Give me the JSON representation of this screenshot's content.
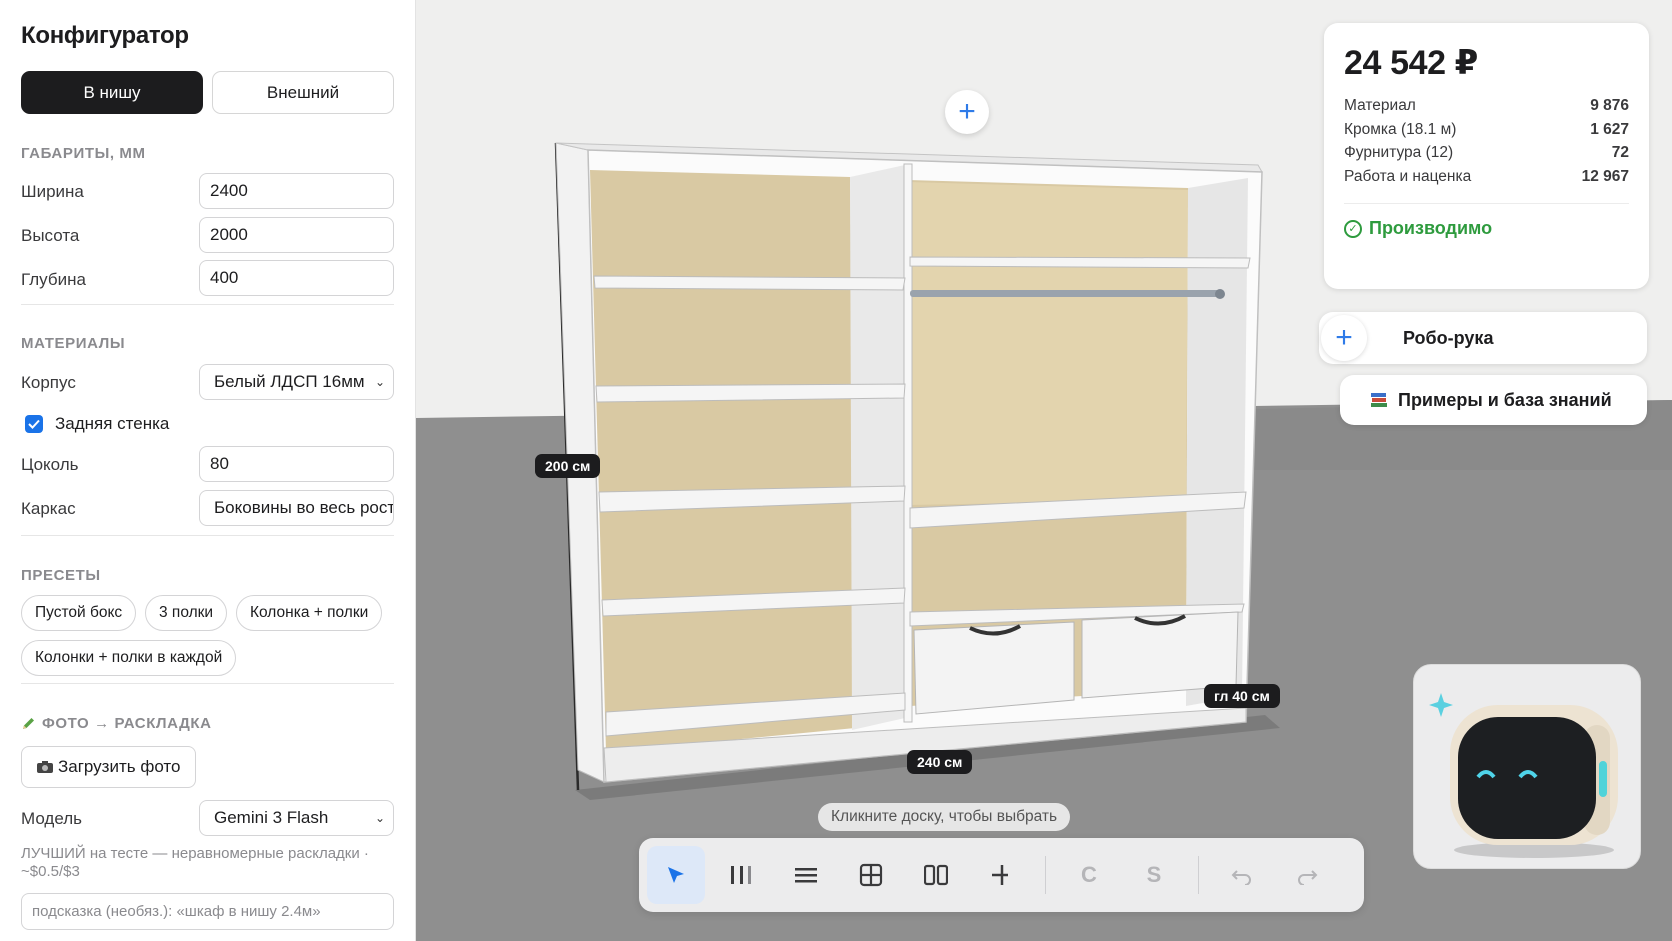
{
  "sidebar": {
    "title": "Конфигуратор",
    "modes": [
      {
        "label": "В нишу",
        "active": true
      },
      {
        "label": "Внешний",
        "active": false
      }
    ],
    "dimensions": {
      "section_label": "ГАБАРИТЫ, ММ",
      "width_label": "Ширина",
      "width_value": "2400",
      "height_label": "Высота",
      "height_value": "2000",
      "depth_label": "Глубина",
      "depth_value": "400"
    },
    "materials": {
      "section_label": "МАТЕРИАЛЫ",
      "body_label": "Корпус",
      "body_value": "Белый ЛДСП 16мм",
      "back_wall_label": "Задняя стенка",
      "back_wall_checked": true,
      "plinth_label": "Цоколь",
      "plinth_value": "80",
      "frame_label": "Каркас",
      "frame_value": "Боковины во весь рост"
    },
    "presets": {
      "section_label": "ПРЕСЕТЫ",
      "items": [
        "Пустой бокс",
        "3 полки",
        "Колонка + полки",
        "Колонки + полки в каждой"
      ]
    },
    "photo": {
      "section_label": "ФОТО → РАСКЛАДКА",
      "upload_label": "Загрузить фото",
      "model_label": "Модель",
      "model_value": "Gemini 3 Flash",
      "hint": "ЛУЧШИЙ на тесте — неравномерные раскладки · ~$0.5/$3",
      "prompt_placeholder": "подсказка (необяз.): «шкаф в нишу 2.4м»"
    }
  },
  "viewport": {
    "height_badge": "200 см",
    "width_badge": "240 см",
    "depth_badge": "гл 40 см",
    "click_hint": "Кликните доску, чтобы выбрать",
    "toolbar": [
      {
        "icon": "select-arrow-icon",
        "active": true
      },
      {
        "icon": "vertical-divider-icon"
      },
      {
        "icon": "shelf-icon"
      },
      {
        "icon": "grid-icon"
      },
      {
        "icon": "columns-icon"
      },
      {
        "icon": "insert-icon"
      },
      {
        "text": "C",
        "disabled": true
      },
      {
        "text": "S",
        "disabled": true
      },
      {
        "icon": "undo-icon",
        "disabled": true
      },
      {
        "icon": "redo-icon",
        "disabled": true
      }
    ]
  },
  "price": {
    "total": "24 542 ₽",
    "rows": [
      {
        "label": "Материал",
        "value": "9 876"
      },
      {
        "label": "Кромка (18.1 м)",
        "value": "1 627"
      },
      {
        "label": "Фурнитура (12)",
        "value": "72"
      },
      {
        "label": "Работа и наценка",
        "value": "12 967"
      }
    ],
    "status": "Производимо",
    "status_color": "#2e9b3e"
  },
  "actions": {
    "robo_arm": "Робо-рука",
    "knowledge_base": "Примеры и база знаний"
  },
  "colors": {
    "accent": "#2f7be8",
    "dark": "#1c1c1e",
    "back_panel": "#d9c9a3",
    "floor": "#8f8f8f"
  }
}
